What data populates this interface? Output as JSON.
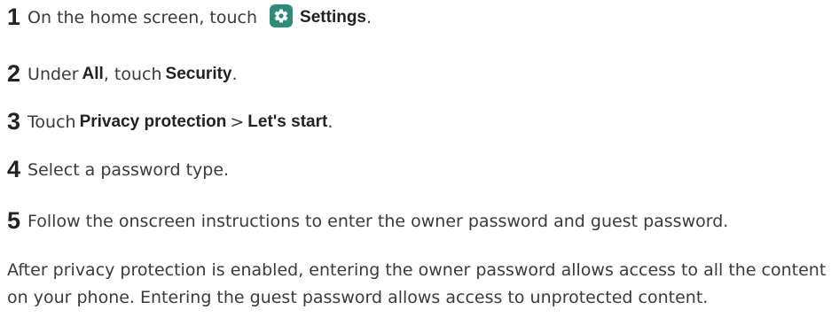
{
  "steps": [
    {
      "number": "1",
      "pre": "On the home screen, touch",
      "icon": "settings-gear-icon",
      "bold": "Settings",
      "post": "."
    },
    {
      "number": "2",
      "pre": "Under",
      "bold1": "All",
      "mid": ", touch",
      "bold2": "Security",
      "post": "."
    },
    {
      "number": "3",
      "pre": "Touch",
      "bold1": "Privacy protection",
      "sep": ">",
      "bold2": "Let's start",
      "post": "."
    },
    {
      "number": "4",
      "text": "Select a password type."
    },
    {
      "number": "5",
      "text": "Follow the onscreen instructions to enter the owner password and guest password."
    }
  ],
  "note": "After privacy protection is enabled, entering the owner password allows access to all the content on your phone. Entering the guest password allows access to unprotected content.",
  "colors": {
    "icon_bg": "#2f8a7a",
    "text": "#3a3a3a",
    "heading": "#222222"
  }
}
